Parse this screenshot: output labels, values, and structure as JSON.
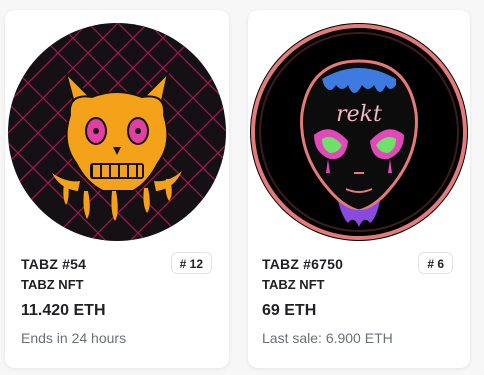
{
  "cards": [
    {
      "name": "TABZ #54",
      "collection": "TABZ NFT",
      "price": "11.420 ETH",
      "subtext": "Ends in 24 hours",
      "rank": "# 12",
      "image": "cat-skull-artwork"
    },
    {
      "name": "TABZ #6750",
      "collection": "TABZ NFT",
      "price": "69 ETH",
      "subtext": "Last sale: 6.900 ETH",
      "rank": "# 6",
      "image": "alien-head-artwork",
      "art_text": "rekt"
    }
  ],
  "colors": {
    "card_bg": "#ffffff",
    "text_primary": "#1f1f24",
    "text_secondary": "#6b6f78",
    "art_left_bg": "#141014",
    "art_left_grid": "#c2185b",
    "art_left_figure": "#f4a21a",
    "art_right_bg": "#000000",
    "art_right_accent": "#e57a7a"
  }
}
